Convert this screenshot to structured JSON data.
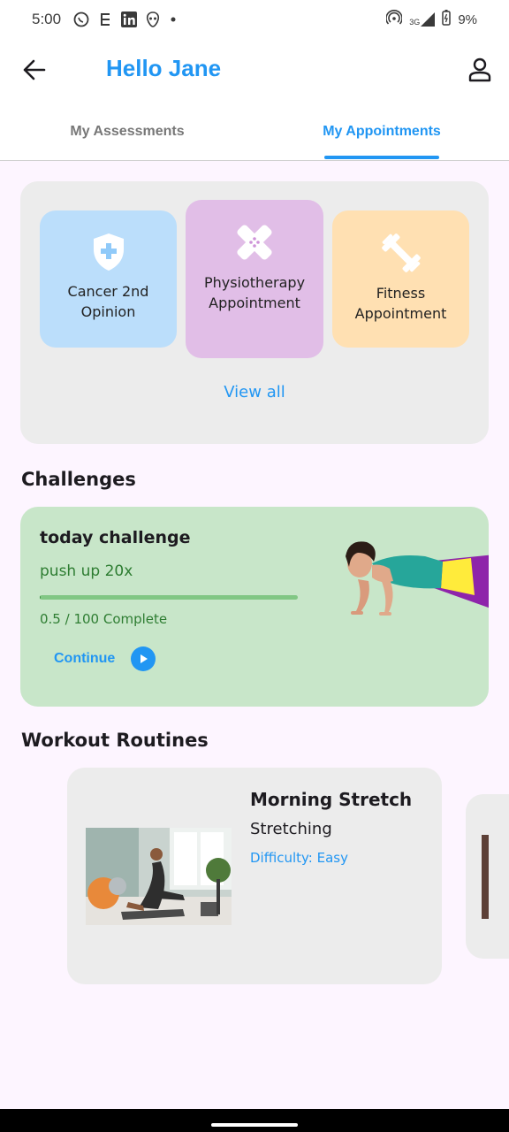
{
  "status_bar": {
    "time": "5:00",
    "battery": "9%",
    "network": "3G",
    "left_icons": [
      "whatsapp-icon",
      "gmail-icon",
      "linkedin-icon",
      "alien-icon",
      "dot-icon"
    ],
    "right_icons": [
      "hotspot-icon",
      "signal-icon",
      "battery-icon"
    ]
  },
  "header": {
    "title": "Hello Jane",
    "back_icon": "arrow-left-icon",
    "profile_icon": "person-icon"
  },
  "tabs": [
    {
      "label": "My Assessments",
      "active": false
    },
    {
      "label": "My Appointments",
      "active": true
    }
  ],
  "appointments": {
    "tiles": [
      {
        "label": "Cancer 2nd Opinion",
        "icon": "shield-plus-icon",
        "color": "#bbdefb"
      },
      {
        "label": "Physiotherapy Appointment",
        "icon": "bandage-icon",
        "color": "#e1bee7"
      },
      {
        "label": "Fitness Appointment",
        "icon": "dumbbell-icon",
        "color": "#ffe0b2"
      }
    ],
    "view_all": "View all"
  },
  "challenges": {
    "section_title": "Challenges",
    "card": {
      "title": "today challenge",
      "subtitle": "push up 20x",
      "progress_text": "0.5 / 100 Complete",
      "progress_fraction": 0.005,
      "continue_label": "Continue",
      "continue_icon": "play-icon",
      "color": "#c8e6c9"
    }
  },
  "workouts": {
    "section_title": "Workout Routines",
    "routines": [
      {
        "title": "Morning Stretch",
        "category": "Stretching",
        "difficulty": "Difficulty: Easy"
      }
    ]
  },
  "colors": {
    "accent": "#2196f3",
    "background": "#fdf5ff",
    "card": "#ececec"
  }
}
